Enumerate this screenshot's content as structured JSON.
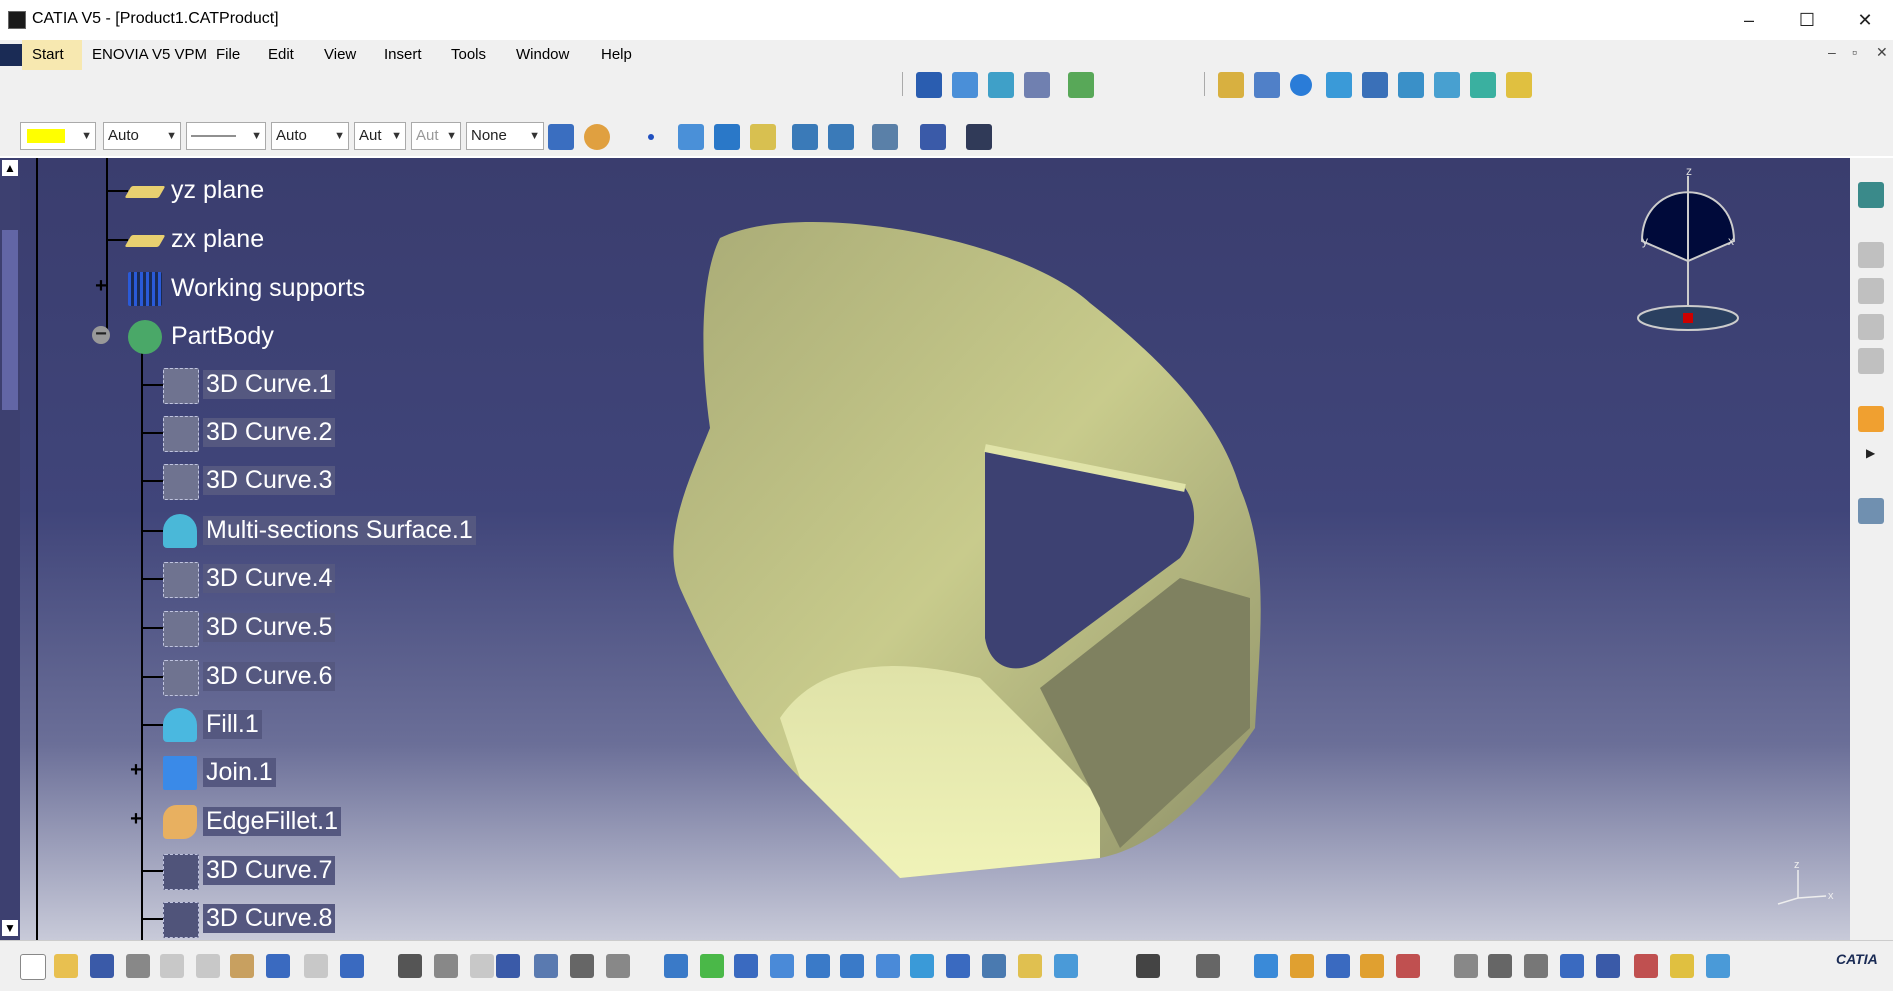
{
  "window": {
    "title": "CATIA V5 - [Product1.CATProduct]",
    "minimize": "–",
    "maximize": "☐",
    "close": "✕"
  },
  "menu": {
    "items": [
      "Start",
      "ENOVIA V5 VPM",
      "File",
      "Edit",
      "View",
      "Insert",
      "Tools",
      "Window",
      "Help"
    ],
    "mdi": [
      "–",
      "▫",
      "✕"
    ]
  },
  "toolbar": {
    "fill_color": "#ffff00",
    "selects": [
      {
        "name": "fill-color-select",
        "value": ""
      },
      {
        "name": "transparency-select",
        "value": "Auto"
      },
      {
        "name": "linetype-select",
        "value": "———"
      },
      {
        "name": "line-weight-select",
        "value": "Auto"
      },
      {
        "name": "point-symbol-select",
        "value": "Aut"
      },
      {
        "name": "rendering-select",
        "value": "Aut"
      },
      {
        "name": "layer-select",
        "value": "None"
      }
    ]
  },
  "tree": {
    "nodes": [
      {
        "label": "yz plane",
        "icon": "plane-icon"
      },
      {
        "label": "zx plane",
        "icon": "plane-icon"
      },
      {
        "label": "Working supports",
        "icon": "grid-icon",
        "expander": "+"
      },
      {
        "label": "PartBody",
        "icon": "gear-icon",
        "expander": "−"
      },
      {
        "label": "3D Curve.1",
        "icon": "curve-icon"
      },
      {
        "label": "3D Curve.2",
        "icon": "curve-icon"
      },
      {
        "label": "3D Curve.3",
        "icon": "curve-icon"
      },
      {
        "label": "Multi-sections Surface.1",
        "icon": "surface-icon"
      },
      {
        "label": "3D Curve.4",
        "icon": "curve-icon"
      },
      {
        "label": "3D Curve.5",
        "icon": "curve-icon"
      },
      {
        "label": "3D Curve.6",
        "icon": "curve-icon"
      },
      {
        "label": "Fill.1",
        "icon": "fill-icon"
      },
      {
        "label": "Join.1",
        "icon": "join-icon",
        "expander": "+"
      },
      {
        "label": "EdgeFillet.1",
        "icon": "edge-fillet-icon",
        "expander": "+"
      },
      {
        "label": "3D Curve.7",
        "icon": "curve-icon"
      },
      {
        "label": "3D Curve.8",
        "icon": "curve-icon"
      }
    ]
  },
  "compass": {
    "axis_labels": [
      "z",
      "y",
      "x"
    ]
  },
  "axis_triad": {
    "labels": [
      "z",
      "x"
    ]
  },
  "colors": {
    "viewport_top": "#3a3d6e",
    "viewport_bottom": "#c8cad9",
    "part": "#c9cc8f",
    "highlight": "#555880"
  },
  "brand": {
    "logo_text": "CATIA"
  }
}
